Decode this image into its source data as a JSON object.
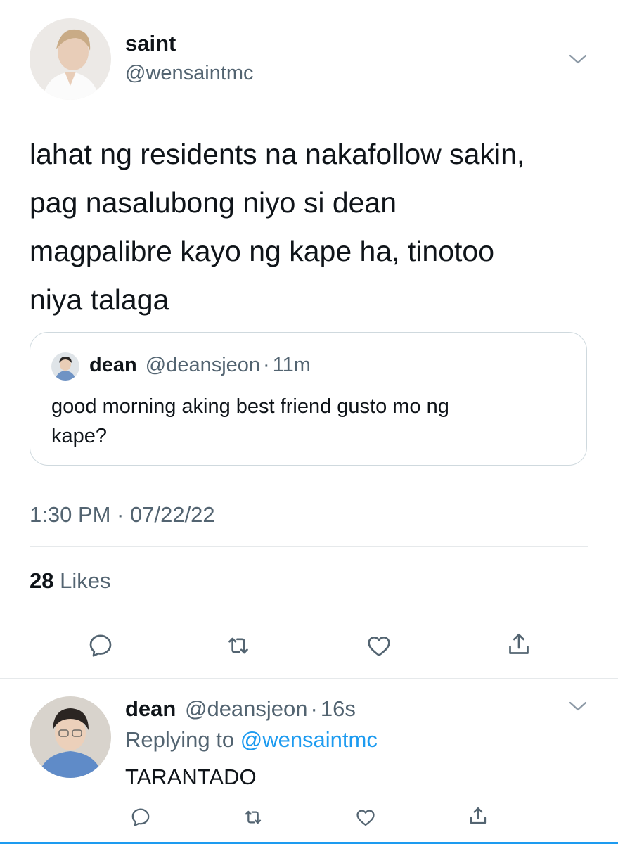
{
  "main_tweet": {
    "display_name": "saint",
    "handle": "@wensaintmc",
    "text_lines": [
      "lahat ng residents na nakafollow sakin,",
      "pag nasalubong niyo si dean",
      "magpalibre kayo ng kape ha, tinotoo",
      "niya talaga"
    ],
    "timestamp": "1:30 PM · 07/22/22",
    "likes_count": "28",
    "likes_label": "Likes"
  },
  "quoted_tweet": {
    "display_name": "dean",
    "handle": "@deansjeon",
    "separator": "·",
    "time": "11m",
    "text_lines": [
      "good morning aking best friend gusto mo ng",
      "kape?"
    ]
  },
  "reply_tweet": {
    "display_name": "dean",
    "handle": "@deansjeon",
    "separator": "·",
    "time": "16s",
    "replying_prefix": "Replying to",
    "replying_to": "@wensaintmc",
    "text": "TARANTADO"
  },
  "colors": {
    "accent": "#1d9bf0",
    "muted": "#536471",
    "divider": "#e6e9eb"
  },
  "icons": [
    "chevron-down-icon",
    "reply-icon",
    "retweet-icon",
    "like-icon",
    "share-icon"
  ]
}
